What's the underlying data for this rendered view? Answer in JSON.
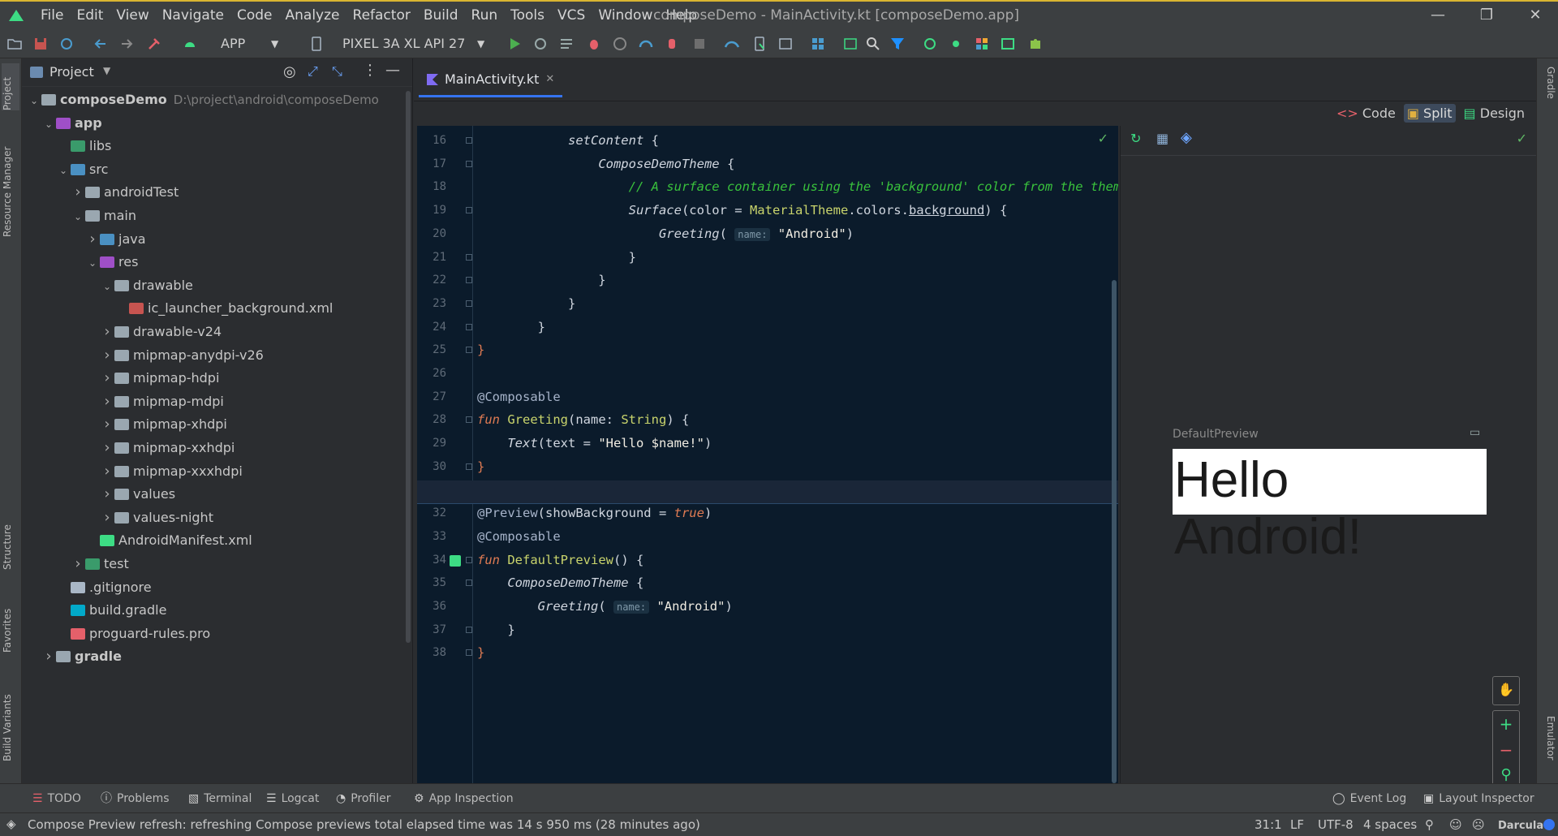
{
  "window": {
    "menu": [
      "File",
      "Edit",
      "View",
      "Navigate",
      "Code",
      "Analyze",
      "Refactor",
      "Build",
      "Run",
      "Tools",
      "VCS",
      "Window",
      "Help"
    ],
    "title": "composeDemo - MainActivity.kt [composeDemo.app]"
  },
  "toolbar": {
    "run_config": "APP",
    "device": "PIXEL 3A XL API 27"
  },
  "left_strip": {
    "tabs": [
      "Project",
      "Resource Manager",
      "Structure",
      "Favorites",
      "Build Variants"
    ]
  },
  "right_strip": {
    "tabs": [
      "Gradle",
      "Emulator"
    ]
  },
  "project_panel": {
    "title": "Project",
    "tree": [
      {
        "label": "composeDemo",
        "extra": "D:\\project\\android\\composeDemo",
        "depth": 0,
        "chev": "v",
        "icon": "folder"
      },
      {
        "label": "app",
        "extra": "",
        "depth": 1,
        "chev": "v",
        "icon": "module"
      },
      {
        "label": "libs",
        "extra": "",
        "depth": 2,
        "chev": "",
        "icon": "folder-green"
      },
      {
        "label": "src",
        "extra": "",
        "depth": 2,
        "chev": "v",
        "icon": "folder-blue"
      },
      {
        "label": "androidTest",
        "extra": "",
        "depth": 3,
        "chev": ">",
        "icon": "folder"
      },
      {
        "label": "main",
        "extra": "",
        "depth": 3,
        "chev": "v",
        "icon": "folder"
      },
      {
        "label": "java",
        "extra": "",
        "depth": 4,
        "chev": ">",
        "icon": "folder-blue"
      },
      {
        "label": "res",
        "extra": "",
        "depth": 4,
        "chev": "v",
        "icon": "folder-res"
      },
      {
        "label": "drawable",
        "extra": "",
        "depth": 5,
        "chev": "v",
        "icon": "folder"
      },
      {
        "label": "ic_launcher_background.xml",
        "extra": "",
        "depth": 6,
        "chev": "",
        "icon": "xml"
      },
      {
        "label": "drawable-v24",
        "extra": "",
        "depth": 5,
        "chev": ">",
        "icon": "folder"
      },
      {
        "label": "mipmap-anydpi-v26",
        "extra": "",
        "depth": 5,
        "chev": ">",
        "icon": "folder"
      },
      {
        "label": "mipmap-hdpi",
        "extra": "",
        "depth": 5,
        "chev": ">",
        "icon": "folder"
      },
      {
        "label": "mipmap-mdpi",
        "extra": "",
        "depth": 5,
        "chev": ">",
        "icon": "folder"
      },
      {
        "label": "mipmap-xhdpi",
        "extra": "",
        "depth": 5,
        "chev": ">",
        "icon": "folder"
      },
      {
        "label": "mipmap-xxhdpi",
        "extra": "",
        "depth": 5,
        "chev": ">",
        "icon": "folder"
      },
      {
        "label": "mipmap-xxxhdpi",
        "extra": "",
        "depth": 5,
        "chev": ">",
        "icon": "folder"
      },
      {
        "label": "values",
        "extra": "",
        "depth": 5,
        "chev": ">",
        "icon": "folder"
      },
      {
        "label": "values-night",
        "extra": "",
        "depth": 5,
        "chev": ">",
        "icon": "folder"
      },
      {
        "label": "AndroidManifest.xml",
        "extra": "",
        "depth": 4,
        "chev": "",
        "icon": "android"
      },
      {
        "label": "test",
        "extra": "",
        "depth": 3,
        "chev": ">",
        "icon": "folder-green"
      },
      {
        "label": ".gitignore",
        "extra": "",
        "depth": 2,
        "chev": "",
        "icon": "git"
      },
      {
        "label": "build.gradle",
        "extra": "",
        "depth": 2,
        "chev": "",
        "icon": "gradle"
      },
      {
        "label": "proguard-rules.pro",
        "extra": "",
        "depth": 2,
        "chev": "",
        "icon": "pro"
      },
      {
        "label": "gradle",
        "extra": "",
        "depth": 1,
        "chev": ">",
        "icon": "folder"
      }
    ]
  },
  "editor": {
    "tab": "MainActivity.kt",
    "view_modes": [
      "Code",
      "Split",
      "Design"
    ],
    "active_line": 31,
    "lines": [
      {
        "n": "16",
        "html": "            <span class=\"it\">setContent</span> {"
      },
      {
        "n": "17",
        "html": "                <span class=\"it\">ComposeDemoTheme</span> {"
      },
      {
        "n": "18",
        "html": "                    <span class=\"cmt\">// A surface container using the 'background' color from the theme</span>"
      },
      {
        "n": "19",
        "html": "                    <span class=\"it\">Surface</span>(color = <span class=\"fn\">MaterialTheme</span>.colors.<u>background</u>) {"
      },
      {
        "n": "20",
        "html": "                        <span class=\"it\">Greeting</span>( <span class=\"hint\">name:</span> <span class=\"str\">\"Android\"</span>)"
      },
      {
        "n": "21",
        "html": "                    }"
      },
      {
        "n": "22",
        "html": "                }"
      },
      {
        "n": "23",
        "html": "            }"
      },
      {
        "n": "24",
        "html": "        }"
      },
      {
        "n": "25",
        "html": "<span class=\"kw\">}</span>"
      },
      {
        "n": "26",
        "html": ""
      },
      {
        "n": "27",
        "html": "<span class=\"ann\">@Composable</span>"
      },
      {
        "n": "28",
        "html": "<span class=\"kw it\">fun</span> <span class=\"fn\">Greeting</span>(name: <span class=\"fn\">String</span>) {"
      },
      {
        "n": "29",
        "html": "    <span class=\"it\">Text</span>(text = <span class=\"str\">\"Hello $name!\"</span>)"
      },
      {
        "n": "30",
        "html": "<span class=\"kw\">}</span>"
      },
      {
        "n": "31",
        "html": ""
      },
      {
        "n": "32",
        "html": "<span class=\"ann\">@Preview</span>(showBackground = <span class=\"kw it\">true</span>)"
      },
      {
        "n": "33",
        "html": "<span class=\"ann\">@Composable</span>"
      },
      {
        "n": "34",
        "html": "<span class=\"kw it\">fun</span> <span class=\"fn\">DefaultPreview</span>() {"
      },
      {
        "n": "35",
        "html": "    <span class=\"it\">ComposeDemoTheme</span> {"
      },
      {
        "n": "36",
        "html": "        <span class=\"it\">Greeting</span>( <span class=\"hint\">name:</span> <span class=\"str\">\"Android\"</span>)"
      },
      {
        "n": "37",
        "html": "    }"
      },
      {
        "n": "38",
        "html": "<span class=\"kw\">}</span>"
      }
    ]
  },
  "preview": {
    "label": "DefaultPreview",
    "rendered_text": "Hello Android!"
  },
  "bottom_tools": {
    "left": [
      "TODO",
      "Problems",
      "Terminal",
      "Logcat",
      "Profiler",
      "App Inspection"
    ],
    "right": [
      "Event Log",
      "Layout Inspector"
    ]
  },
  "status": {
    "message": "Compose Preview refresh: refreshing Compose previews total elapsed time was 14 s 950 ms (28 minutes ago)",
    "position": "31:1",
    "line_sep": "LF",
    "encoding": "UTF-8",
    "indent": "4 spaces",
    "theme": "Darcula"
  },
  "colors": {
    "accent": "#3574f0",
    "editor_bg": "#0b1b2b",
    "panel_bg": "#2b2d30",
    "run_green": "#4caf50"
  }
}
